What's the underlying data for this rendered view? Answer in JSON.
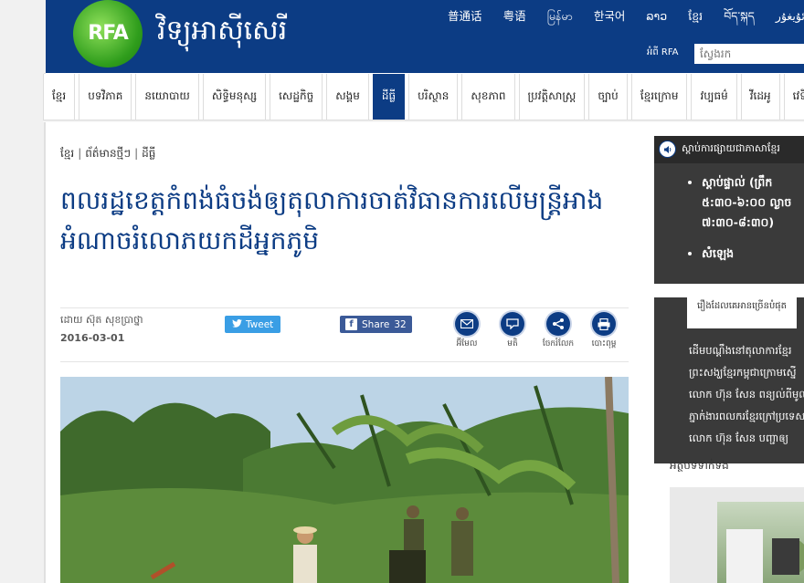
{
  "header": {
    "logo_text": "RFA",
    "site_title": "វិទ្យុអាស៊ីសេរី",
    "languages": [
      "普通话",
      "粤语",
      "မြန်မာ",
      "한국어",
      "ລາວ",
      "ខ្មែរ",
      "བོད་སྐད",
      "ئۇيغۇر"
    ],
    "about_link": "អំពី RFA",
    "search_placeholder": "ស្វែងរក"
  },
  "nav": {
    "items": [
      "ខ្មែរ",
      "បទវិភាគ",
      "នយោបាយ",
      "សិទ្ធិមនុស្ស",
      "សេដ្ឋកិច្ច",
      "សង្គម",
      "ដីធ្លី",
      "បរិស្ថាន",
      "សុខភាព",
      "ប្រវត្តិសាស្ត្រ",
      "ច្បាប់",
      "ខ្មែរក្រោម",
      "វប្បធម៌",
      "វីដេអូ",
      "វេទិកាអ្នក"
    ],
    "active_index": 6
  },
  "article": {
    "breadcrumb": [
      "ខ្មែរ",
      "ព័ត៌មានថ្មីៗ",
      "ដីធ្លី"
    ],
    "title": "ពលរដ្ឋខេត្តកំពង់ធំចង់ឲ្យតុលាការចាត់វិធានការលើមន្ត្រីអាងអំណាចរំលោភយកដីអ្នកភូមិ",
    "author": "ដោយ ស៊ុត សុខប្រាថ្នា",
    "date": "2016-03-01",
    "tweet_label": "Tweet",
    "share_label": "Share",
    "share_count": "32",
    "tools": [
      {
        "label": "អ៊ីមែល",
        "icon": "email-icon"
      },
      {
        "label": "មតិ",
        "icon": "comment-icon"
      },
      {
        "label": "ចែករំលែក",
        "icon": "share-icon"
      },
      {
        "label": "បោះពុម្ព",
        "icon": "print-icon"
      }
    ]
  },
  "sidebar": {
    "radio": {
      "title": "ស្ដាប់ការផ្សាយជាភាសាខ្មែរ",
      "items": [
        "ស្ដាប់ផ្ទាល់ (ព្រឹក ៥:៣០-៦:០០ ល្ងាច ៧:៣០-៨:៣០)",
        "សំឡេង"
      ]
    },
    "popular": {
      "title": "រឿងដែលគេអានច្រើនបំផុត",
      "items": [
        "ដើមបណ្ដឹងនៅតុលាការខ្មែរ",
        "ព្រះសង្ឃខ្មែរកម្ពុជាក្រោមស្នើ",
        "លោក ហ៊ុន សែន ពន្យល់ពីមូលហេតុ",
        "ភ្នាក់ងារពលករខ្មែរក្រៅប្រទេស",
        "លោក ហ៊ុន សែន បញ្ជាឲ្យ"
      ]
    },
    "more_title": "អត្ថបទទាក់ទង"
  }
}
